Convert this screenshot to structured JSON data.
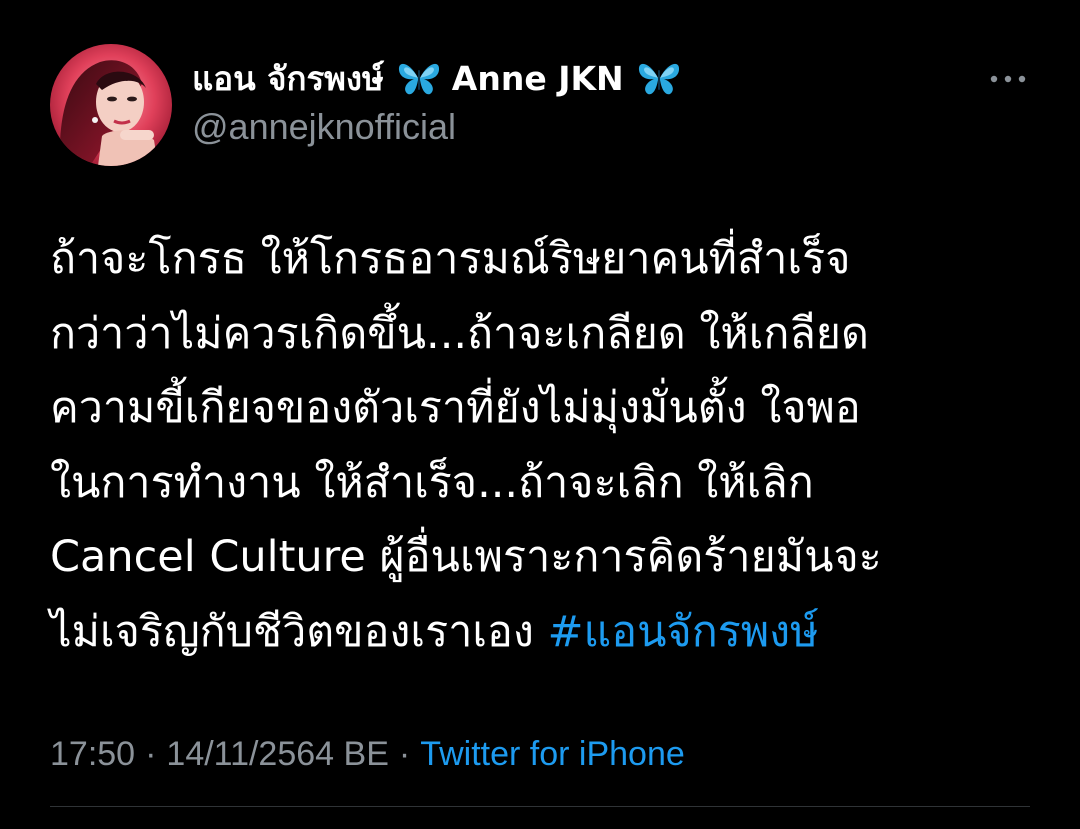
{
  "user": {
    "display_name_thai": "แอน จักรพงษ์",
    "display_name_english": "Anne JKN",
    "handle": "@annejknofficial",
    "name_emoji": "butterfly-icon"
  },
  "tweet": {
    "lines": [
      "ถ้าจะโกรธ ให้โกรธอารมณ์ริษยาคนที่สำเร็จ",
      "กว่าว่าไม่ควรเกิดขึ้น...ถ้าจะเกลียด ให้เกลียด",
      "ความขี้เกียจของตัวเราที่ยังไม่มุ่งมั่นตั้ง ใจพอ",
      " ในการทำงาน ให้สำเร็จ...ถ้าจะเลิก ให้เลิก",
      "Cancel Culture ผู้อื่นเพราะการคิดร้ายมันจะ"
    ],
    "last_line_text": "ไม่เจริญกับชีวิตของเราเอง ",
    "hashtag": "#แอนจักรพงษ์"
  },
  "meta": {
    "time": "17:50",
    "separator": "·",
    "date": "14/11/2564 BE",
    "source": "Twitter for iPhone"
  },
  "colors": {
    "background": "#000000",
    "text": "#ffffff",
    "secondary": "#8b9299",
    "accent": "#1d9bf0",
    "divider": "#2f3336"
  }
}
